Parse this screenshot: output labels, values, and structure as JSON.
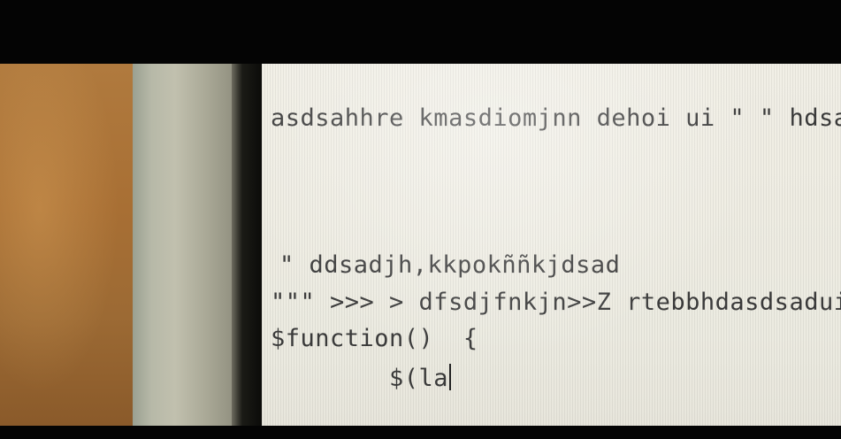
{
  "editor": {
    "lines": [
      "asdsahhre kmasdiomjnn dehoi ui \" \" hdsa",
      "\" ddsadjh,kkpokññkjdsad",
      "\"\"\" >>> > dfsdjfnkjn>>Z rtebbhdasdsadui",
      "$function()  {",
      "$(la"
    ]
  }
}
